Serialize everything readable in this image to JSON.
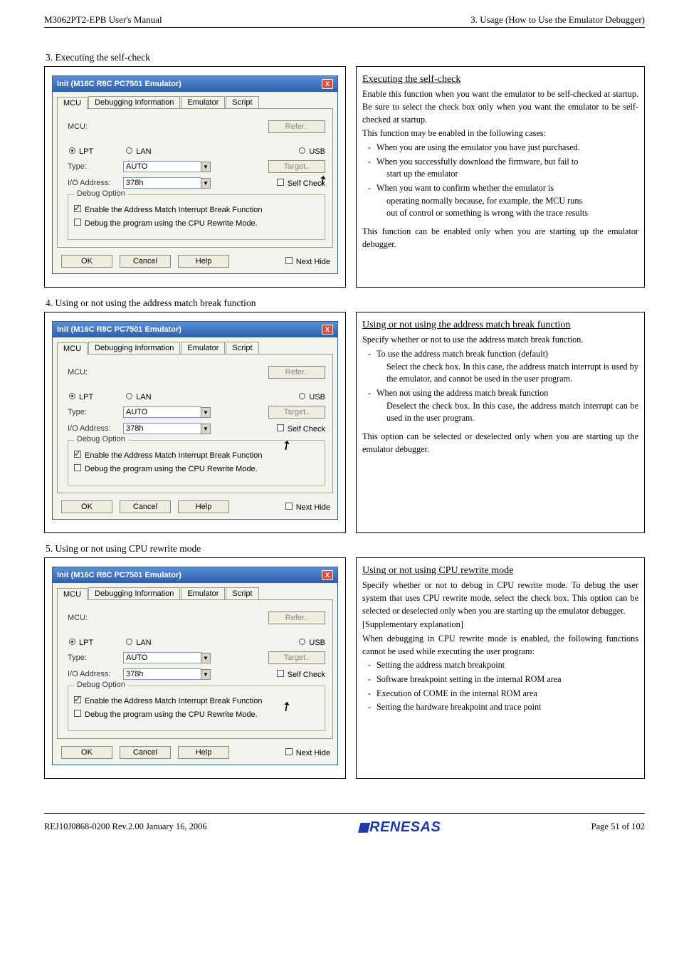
{
  "header": {
    "left": "M3062PT2-EPB User's Manual",
    "right": "3. Usage (How to Use the Emulator Debugger)"
  },
  "sections": {
    "s3": {
      "num": "3. Executing the self-check"
    },
    "s4": {
      "num": "4. Using or not using the address match break function"
    },
    "s5": {
      "num": "5. Using or not using CPU rewrite mode"
    }
  },
  "dlg": {
    "title": "Init (M16C R8C PC7501 Emulator)",
    "tabs": {
      "mcu": "MCU",
      "debug": "Debugging Information",
      "emu": "Emulator",
      "script": "Script"
    },
    "mcuLabel": "MCU:",
    "refer": "Refer..",
    "lpt": "LPT",
    "lan": "LAN",
    "usb": "USB",
    "typeLabel": "Type:",
    "typeVal": "AUTO",
    "target": "Target..",
    "ioLabel": "I/O Address:",
    "ioVal": "378h",
    "selfcheck": "Self Check",
    "debugOpt": "Debug Option",
    "opt1": "Enable the Address Match Interrupt Break Function",
    "opt2": "Debug the program using the CPU Rewrite Mode.",
    "ok": "OK",
    "cancel": "Cancel",
    "help": "Help",
    "nexthide": "Next Hide"
  },
  "expl3": {
    "title": "Executing the self-check",
    "p1": "Enable this function when you want the emulator to be self-checked at startup. Be sure to select the check box only when you want the emulator to be self-checked at startup.",
    "p2": "This function may be enabled in the following cases:",
    "b1": "When you are using the emulator you have just purchased.",
    "b2a": "When you successfully download the firmware, but fail to",
    "b2b": "start up the emulator",
    "b3a": "When you want to confirm whether the emulator is",
    "b3b": "operating normally because, for example, the MCU runs",
    "b3c": "out of control or something is wrong with the trace results",
    "p3": "This function can be enabled only when you are starting up the emulator debugger."
  },
  "expl4": {
    "title": "Using or not using the address match break function",
    "p1": "Specify whether or not to use the address match break function.",
    "b1": "To use the address match break function (default)",
    "b1a": "Select the check box. In this case, the address match interrupt is used by the emulator, and cannot be used in the user program.",
    "b2": "When not using the address match break function",
    "b2a": "Deselect the check box. In this case, the address match interrupt can be used in the user program.",
    "p2": "This option can be selected or deselected only when you are starting up the emulator debugger."
  },
  "expl5": {
    "title": "Using or not using CPU rewrite mode",
    "p1": "Specify whether or not to debug in CPU rewrite mode. To debug the user system that uses CPU rewrite mode, select the check box. This option can be selected or deselected only when you are starting up the emulator debugger.",
    "p2": "[Supplementary explanation]",
    "p3": "When debugging in CPU rewrite mode is enabled, the following functions cannot be used while executing the user program:",
    "b1": "Setting the address match breakpoint",
    "b2": "Software breakpoint setting in the internal ROM area",
    "b3": "Execution of COME in the internal ROM area",
    "b4": "Setting the hardware breakpoint and trace point"
  },
  "footer": {
    "left": "REJ10J0868-0200   Rev.2.00   January 16, 2006",
    "brand": "RENESAS",
    "right": "Page 51 of 102"
  }
}
